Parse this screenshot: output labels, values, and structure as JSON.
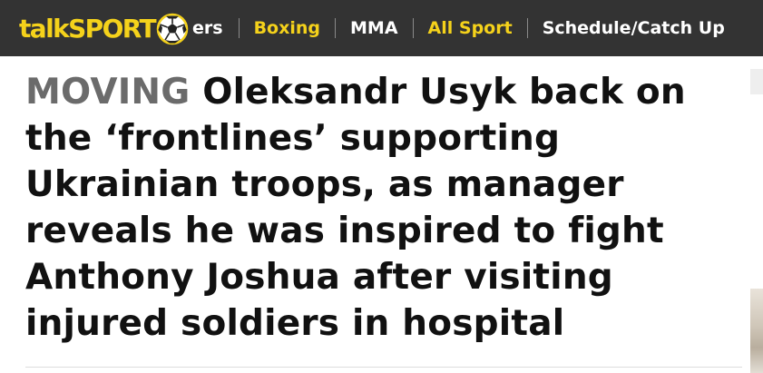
{
  "site": {
    "logo_text": "talkSPORT",
    "logo_icon": "football-icon",
    "brand_yellow": "#f5d21b",
    "nav_background": "#333333"
  },
  "nav": {
    "items": [
      {
        "label": "ers",
        "accent": false
      },
      {
        "label": "Boxing",
        "accent": true
      },
      {
        "label": "MMA",
        "accent": false
      },
      {
        "label": "All Sport",
        "accent": true
      },
      {
        "label": "Schedule/Catch Up",
        "accent": false
      }
    ]
  },
  "article": {
    "kicker": "MOVING",
    "headline": "Oleksandr Usyk back on the ‘frontlines’ supporting Ukrainian troops, as manager reveals he was inspired to fight Anthony Joshua after visiting injured soldiers in hospital",
    "kicker_color": "#6b6b6b"
  }
}
